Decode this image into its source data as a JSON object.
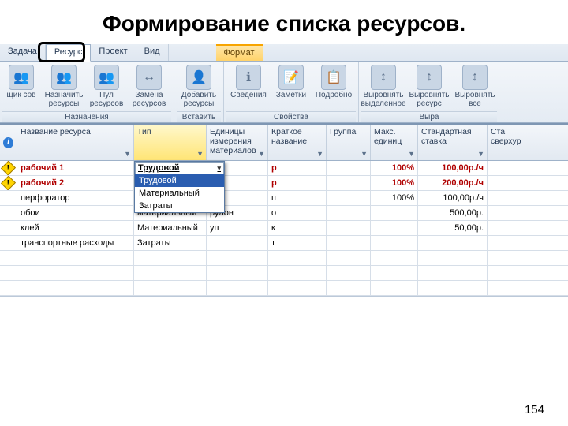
{
  "slide": {
    "title": "Формирование списка ресурсов.",
    "page_number": "154"
  },
  "tabs": {
    "task": "Задача",
    "resource": "Ресурс",
    "project": "Проект",
    "view": "Вид",
    "format": "Формат"
  },
  "ribbon": {
    "groups": {
      "assignments": {
        "title": "Назначения",
        "btn_planner": "щик\nсов",
        "btn_assign": "Назначить\nресурсы",
        "btn_pool": "Пул\nресурсов",
        "btn_replace": "Замена\nресурсов"
      },
      "insert": {
        "title": "Вставить",
        "btn_add": "Добавить\nресурсы"
      },
      "properties": {
        "title": "Свойства",
        "btn_info": "Сведения",
        "btn_notes": "Заметки",
        "btn_details": "Подробно"
      },
      "level": {
        "title": "Выра",
        "btn_sel": "Выровнять\nвыделенное",
        "btn_res": "Выровнять\nресурс",
        "btn_all": "Выровнять\nвсе"
      }
    }
  },
  "grid": {
    "headers": {
      "name": "Название ресурса",
      "type": "Тип",
      "unit": "Единицы\nизмерения\nматериалов",
      "short": "Краткое\nназвание",
      "group": "Группа",
      "max": "Макс.\nединиц",
      "rate": "Стандартная\nставка",
      "over": "Ста\nсверхур"
    },
    "rows": [
      {
        "warn": true,
        "red": true,
        "name": "рабочий 1",
        "type": "Трудовой",
        "unit": "",
        "short": "р",
        "group": "",
        "max": "100%",
        "rate": "100,00р./ч"
      },
      {
        "warn": true,
        "red": true,
        "name": "рабочий 2",
        "type": "",
        "unit": "",
        "short": "р",
        "group": "",
        "max": "100%",
        "rate": "200,00р./ч"
      },
      {
        "warn": false,
        "red": false,
        "name": "перфоратор",
        "type": "",
        "unit": "",
        "short": "п",
        "group": "",
        "max": "100%",
        "rate": "100,00р./ч"
      },
      {
        "warn": false,
        "red": false,
        "name": "обои",
        "type": "материальный",
        "unit": "рулон",
        "short": "о",
        "group": "",
        "max": "",
        "rate": "500,00р."
      },
      {
        "warn": false,
        "red": false,
        "name": "клей",
        "type": "Материальный",
        "unit": "уп",
        "short": "к",
        "group": "",
        "max": "",
        "rate": "50,00р."
      },
      {
        "warn": false,
        "red": false,
        "name": "транспортные расходы",
        "type": "Затраты",
        "unit": "",
        "short": "т",
        "group": "",
        "max": "",
        "rate": ""
      }
    ],
    "dropdown": {
      "selected": "Трудовой",
      "options": [
        "Трудовой",
        "Материальный",
        "Затраты"
      ]
    }
  }
}
